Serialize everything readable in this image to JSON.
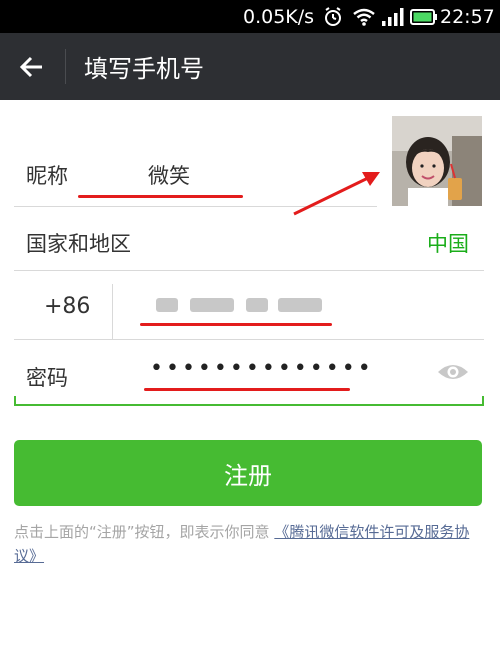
{
  "status_bar": {
    "net_speed": "0.05K/s",
    "time": "22:57"
  },
  "header": {
    "title": "填写手机号"
  },
  "form": {
    "nickname_label": "昵称",
    "nickname_value": "微笑",
    "region_label": "国家和地区",
    "region_value": "中国",
    "country_code": "+86",
    "password_label": "密码",
    "password_mask": "••••••••••••••"
  },
  "register_button": {
    "label": "注册"
  },
  "terms": {
    "prefix": "点击上面的“注册”按钮，即表示你同意",
    "link": "《腾讯微信软件许可及服务协议》"
  },
  "colors": {
    "accent_green": "#46bb32",
    "region_green": "#1aad19",
    "app_bar": "#2d2f33",
    "link_blue": "#576b95",
    "annotation_red": "#e31c1c"
  }
}
